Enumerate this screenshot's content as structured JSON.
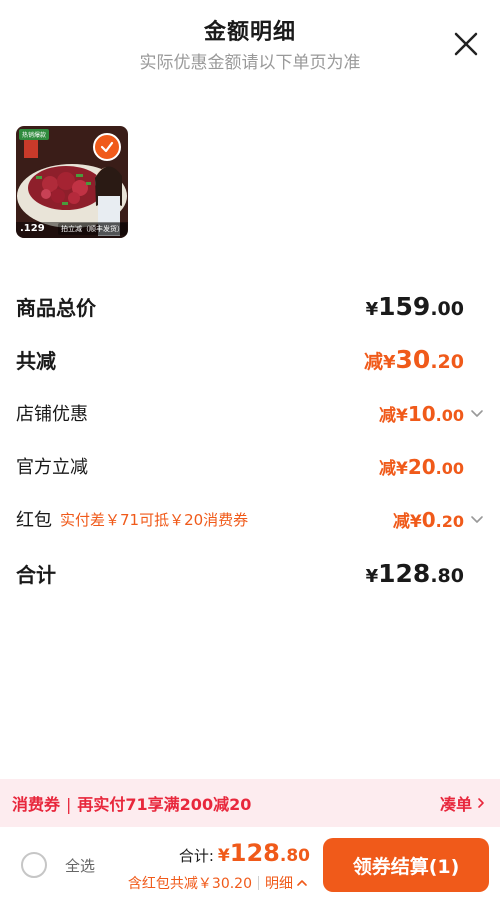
{
  "header": {
    "title": "金额明细",
    "subtitle": "实际优惠金额请以下单页为准",
    "close_icon": "close-icon"
  },
  "product": {
    "image": "red-meat-dish-image",
    "selected": true,
    "price_tag": ".129",
    "ship_tag": "拍立减（顺丰发货）",
    "badge": "热销爆款"
  },
  "rows": {
    "goods_total": {
      "label": "商品总价",
      "currency": "¥",
      "int": "159",
      "dec": ".00"
    },
    "total_reduce": {
      "label": "共减",
      "prefix": "减",
      "currency": "¥",
      "int": "30",
      "dec": ".20"
    },
    "shop_discount": {
      "label": "店铺优惠",
      "prefix": "减",
      "currency": "¥",
      "int": "10",
      "dec": ".00"
    },
    "official_discount": {
      "label": "官方立减",
      "prefix": "减",
      "currency": "¥",
      "int": "20",
      "dec": ".00"
    },
    "red_packet": {
      "label": "红包",
      "note": "实付差￥71可抵￥20消费券",
      "prefix": "减",
      "currency": "¥",
      "int": "0",
      "dec": ".20"
    },
    "sum": {
      "label": "合计",
      "currency": "¥",
      "int": "128",
      "dec": ".80"
    }
  },
  "coupon_bar": {
    "tag": "消费券",
    "text": "再实付71享满200减20",
    "action": "凑单"
  },
  "bottom": {
    "select_all": "全选",
    "total_label": "合计:",
    "total_currency": "¥",
    "total_int": "128",
    "total_dec": ".80",
    "discount_text": "含红包共减￥30.20",
    "detail_label": "明细",
    "checkout_label": "领券结算(1)"
  },
  "colors": {
    "accent": "#f05a1a",
    "coupon_red": "#e8273c",
    "coupon_bg": "#fdecef"
  }
}
